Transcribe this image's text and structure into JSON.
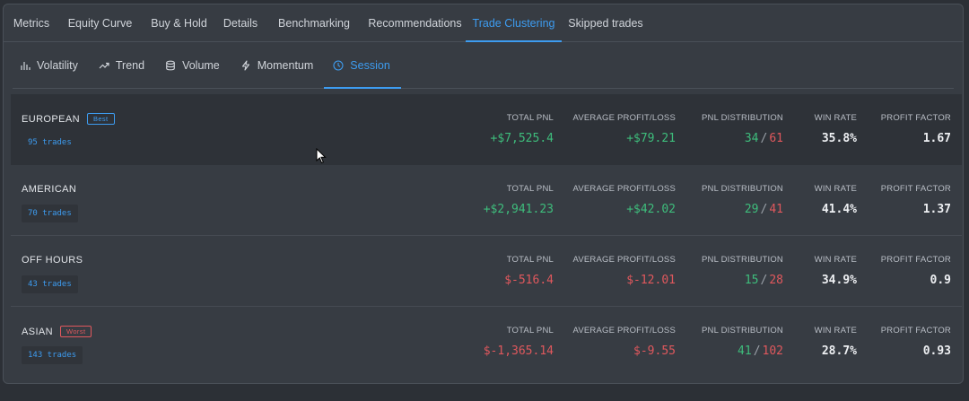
{
  "tabs": [
    {
      "label": "Metrics"
    },
    {
      "label": "Equity Curve"
    },
    {
      "label": "Buy & Hold"
    },
    {
      "label": "Details"
    },
    {
      "label": "Benchmarking"
    },
    {
      "label": "Recommendations"
    },
    {
      "label": "Trade Clustering"
    },
    {
      "label": "Skipped trades"
    }
  ],
  "active_tab": "Trade Clustering",
  "subtabs": [
    {
      "label": "Volatility",
      "icon": "bar-chart-icon"
    },
    {
      "label": "Trend",
      "icon": "trend-up-icon"
    },
    {
      "label": "Volume",
      "icon": "database-icon"
    },
    {
      "label": "Momentum",
      "icon": "lightning-icon"
    },
    {
      "label": "Session",
      "icon": "clock-icon"
    }
  ],
  "active_subtab": "Session",
  "columns": {
    "total_pnl": "TOTAL PNL",
    "avg_pl": "AVERAGE PROFIT/LOSS",
    "pnl_dist": "PNL DISTRIBUTION",
    "win_rate": "WIN RATE",
    "profit_factor": "PROFIT FACTOR"
  },
  "sessions": [
    {
      "name": "EUROPEAN",
      "badge": "Best",
      "trades": "95 trades",
      "total_pnl": "+$7,525.4",
      "avg_pl": "+$79.21",
      "dist_win": "34",
      "dist_loss": "61",
      "win_rate": "35.8%",
      "profit_factor": "1.67",
      "pnl_sign": "pos"
    },
    {
      "name": "AMERICAN",
      "badge": "",
      "trades": "70 trades",
      "total_pnl": "+$2,941.23",
      "avg_pl": "+$42.02",
      "dist_win": "29",
      "dist_loss": "41",
      "win_rate": "41.4%",
      "profit_factor": "1.37",
      "pnl_sign": "pos"
    },
    {
      "name": "OFF HOURS",
      "badge": "",
      "trades": "43 trades",
      "total_pnl": "$-516.4",
      "avg_pl": "$-12.01",
      "dist_win": "15",
      "dist_loss": "28",
      "win_rate": "34.9%",
      "profit_factor": "0.9",
      "pnl_sign": "neg"
    },
    {
      "name": "ASIAN",
      "badge": "Worst",
      "trades": "143 trades",
      "total_pnl": "$-1,365.14",
      "avg_pl": "$-9.55",
      "dist_win": "41",
      "dist_loss": "102",
      "win_rate": "28.7%",
      "profit_factor": "0.93",
      "pnl_sign": "neg"
    }
  ],
  "colors": {
    "accent": "#3d9cf0",
    "positive": "#3ebd7c",
    "negative": "#e0585d"
  }
}
